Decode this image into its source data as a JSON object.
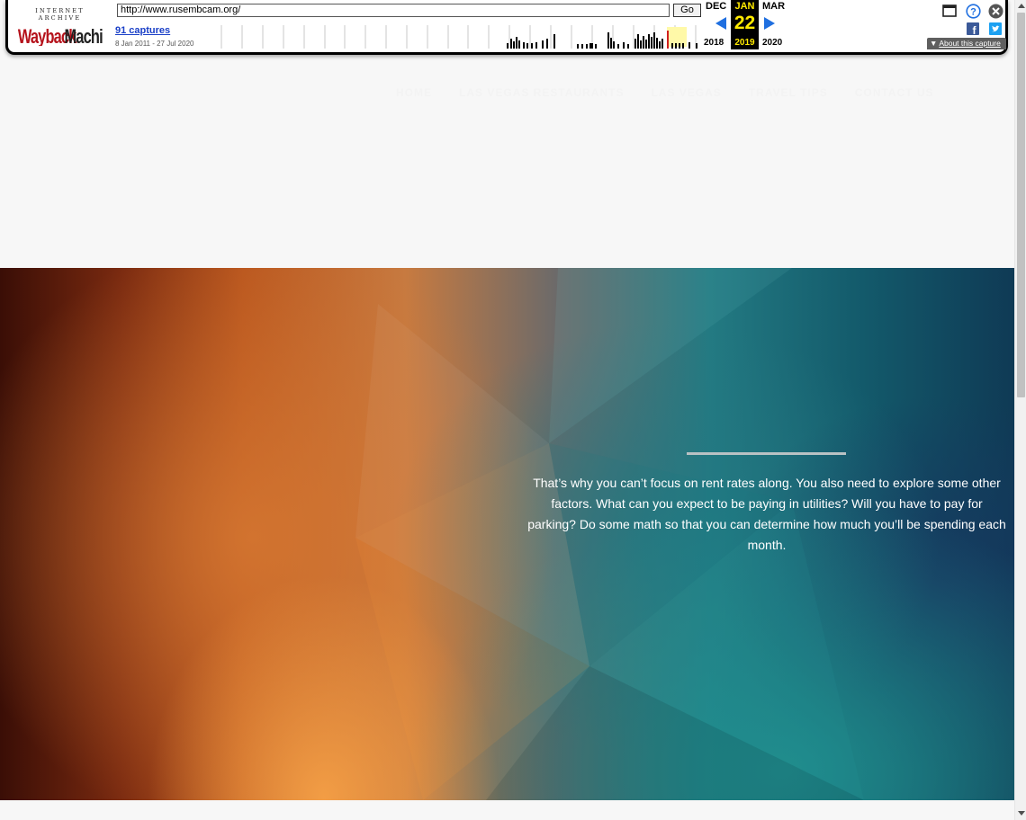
{
  "wayback": {
    "logo_top": "INTERNET ARCHIVE",
    "logo_main": "WaybackMachine",
    "url": "http://www.rusembcam.org/",
    "go_label": "Go",
    "captures_link": "91 captures",
    "capture_range": "8 Jan 2011 - 27 Jul 2020",
    "prev_month": "DEC",
    "current_month": "JAN",
    "next_month": "MAR",
    "current_day": "22",
    "prev_year": "2018",
    "current_year": "2019",
    "next_year": "2020",
    "about_label": "About this capture",
    "icons": [
      "calendar-icon",
      "help-icon",
      "close-icon",
      "facebook-icon",
      "twitter-icon"
    ],
    "accent_blue": "#1f6fe0",
    "highlight_yellow": "#ffea00"
  },
  "nav": {
    "items": [
      {
        "label": "HOME"
      },
      {
        "label": "LAS VEGAS RESTAURANTS"
      },
      {
        "label": "LAS VEGAS"
      },
      {
        "label": "TRAVEL TIPS"
      },
      {
        "label": "CONTACT US"
      }
    ]
  },
  "hero": {
    "text": "That’s why you can’t focus on rent rates along. You also need to explore some other factors. What can you expect to be paying in utilities? Will you have to pay for parking? Do some math so that you can determine how much you’ll be spending each month."
  }
}
